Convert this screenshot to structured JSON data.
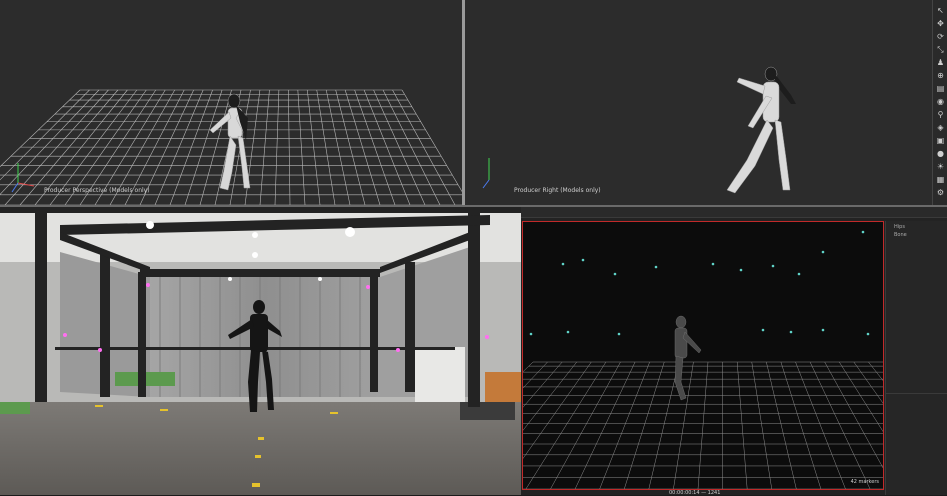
{
  "viewports": {
    "perspective_label": "Producer Perspective (Models only)",
    "right_label": "Producer Right (Models only)"
  },
  "side_panel": {
    "header": "Hips",
    "subheader": "Bone"
  },
  "mocap_view": {
    "footer_info": "00:00:00:14  —  1241",
    "corner_info": "42 markers"
  },
  "toolbar": {
    "icons": [
      "cursor-icon",
      "move-icon",
      "rotate-icon",
      "scale-icon",
      "pose-icon",
      "transform-icon",
      "layer-icon",
      "camera-icon",
      "skeleton-icon",
      "marker-icon",
      "cube-icon",
      "sphere-icon",
      "light-icon",
      "grid-icon",
      "settings-icon"
    ]
  },
  "colors": {
    "viewport_bg": "#2c2c2c",
    "grid": "#bdbdbd",
    "mocap_frame": "#c22a2a",
    "marker": "#5fd3c8"
  }
}
